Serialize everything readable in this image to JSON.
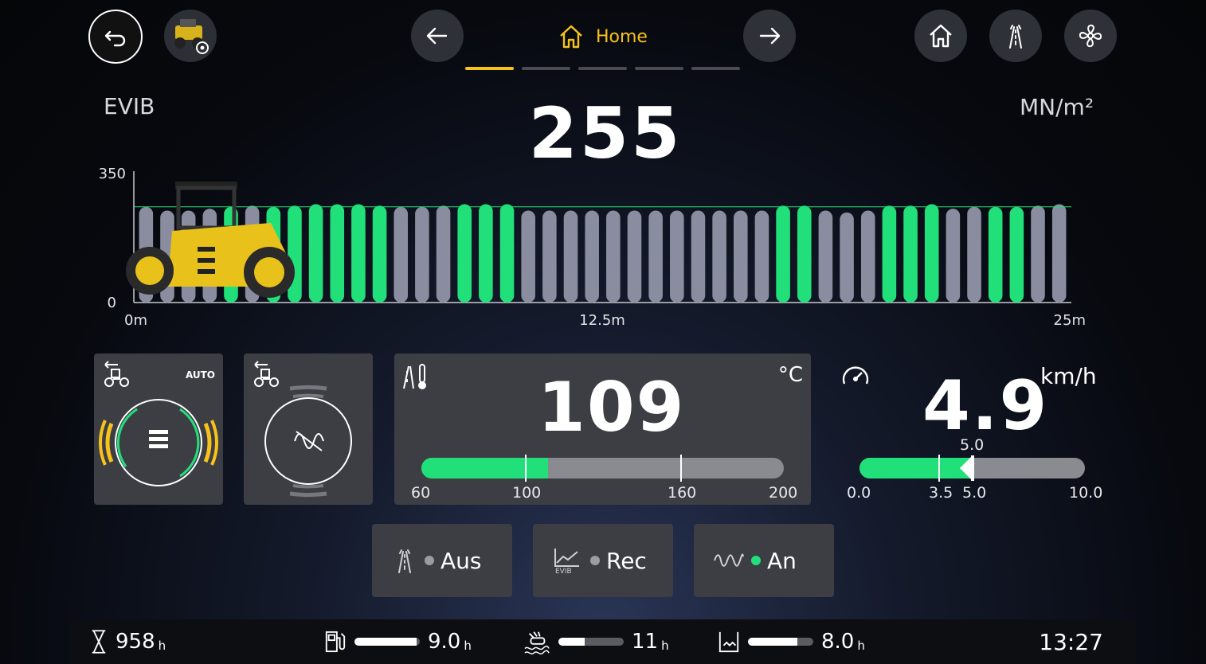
{
  "header": {
    "title": "Home",
    "active_page": 0,
    "page_count": 5
  },
  "evib": {
    "label": "EVIB",
    "value": "255",
    "unit": "MN/m²",
    "target": 255
  },
  "chart_data": {
    "type": "bar",
    "ylim": [
      0,
      350
    ],
    "yticks": [
      "350",
      "0"
    ],
    "xticks": [
      "0m",
      "12.5m",
      "25m"
    ],
    "target_line": 255,
    "values": [
      255,
      245,
      245,
      250,
      255,
      258,
      255,
      258,
      262,
      262,
      262,
      258,
      255,
      255,
      258,
      262,
      262,
      262,
      245,
      245,
      245,
      245,
      245,
      245,
      245,
      245,
      245,
      245,
      245,
      245,
      258,
      258,
      245,
      240,
      245,
      258,
      258,
      262,
      250,
      255,
      255,
      255,
      258,
      262
    ],
    "green": [
      false,
      false,
      false,
      false,
      true,
      false,
      true,
      true,
      true,
      true,
      true,
      true,
      false,
      false,
      false,
      true,
      true,
      true,
      false,
      false,
      false,
      false,
      false,
      false,
      false,
      false,
      false,
      false,
      false,
      false,
      true,
      true,
      false,
      false,
      false,
      true,
      true,
      true,
      false,
      false,
      true,
      true,
      false,
      false
    ]
  },
  "auto_panel": {
    "badge": "AUTO"
  },
  "temperature": {
    "value": "109",
    "unit": "°C",
    "min": 60,
    "max": 200,
    "current": 109,
    "ticks": [
      "60",
      "100",
      "160",
      "200"
    ],
    "marks": [
      100,
      160
    ]
  },
  "speed": {
    "value": "4.9",
    "unit": "km/h",
    "min": 0,
    "max": 10,
    "current": 4.9,
    "setpoint": 5.0,
    "setpoint_label": "5.0",
    "ticks": [
      "0.0",
      "3.5",
      "5.0",
      "10.0"
    ],
    "mark": 3.5
  },
  "modes": [
    {
      "label": "Aus",
      "icon": "road-spray-icon",
      "active": false
    },
    {
      "label": "Rec",
      "icon": "evib-chart-icon",
      "active": false
    },
    {
      "label": "An",
      "icon": "vibration-wave-icon",
      "active": true
    }
  ],
  "status": {
    "hours": {
      "value": "958",
      "unit": "h"
    },
    "fuel": {
      "value": "9.0",
      "unit": "h",
      "level": 0.95
    },
    "water": {
      "value": "11",
      "unit": "h",
      "level": 0.4
    },
    "tank": {
      "value": "8.0",
      "unit": "h",
      "level": 0.75
    },
    "clock": "13:27"
  },
  "colors": {
    "accent": "#f7c21a",
    "green": "#21e07a",
    "bar_gray": "#8a8ca0"
  }
}
